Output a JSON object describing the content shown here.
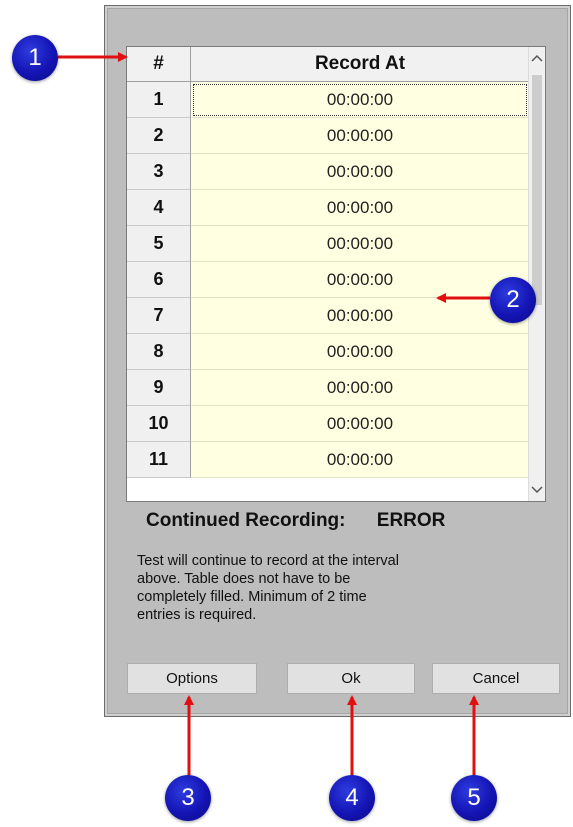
{
  "grid": {
    "header": {
      "index": "#",
      "record_at": "Record At"
    },
    "rows": [
      {
        "index": "1",
        "time": "00:00:00"
      },
      {
        "index": "2",
        "time": "00:00:00"
      },
      {
        "index": "3",
        "time": "00:00:00"
      },
      {
        "index": "4",
        "time": "00:00:00"
      },
      {
        "index": "5",
        "time": "00:00:00"
      },
      {
        "index": "6",
        "time": "00:00:00"
      },
      {
        "index": "7",
        "time": "00:00:00"
      },
      {
        "index": "8",
        "time": "00:00:00"
      },
      {
        "index": "9",
        "time": "00:00:00"
      },
      {
        "index": "10",
        "time": "00:00:00"
      },
      {
        "index": "11",
        "time": "00:00:00"
      }
    ],
    "scroll_up_icon": "chevron-up-icon",
    "scroll_down_icon": "chevron-down-icon"
  },
  "status": {
    "label": "Continued Recording:",
    "value": "ERROR"
  },
  "description": {
    "lines": [
      "Test will continue to record at the interval",
      "above.  Table does not have to be",
      "completely filled.  Minimum of 2 time",
      "entries is required."
    ]
  },
  "buttons": {
    "options": "Options",
    "ok": "Ok",
    "cancel": "Cancel"
  },
  "callouts": {
    "m1": "1",
    "m2": "2",
    "m3": "3",
    "m4": "4",
    "m5": "5"
  },
  "colors": {
    "dialog_bg": "#bdbdbd",
    "cell_yellow": "#ffffe1",
    "marker_blue": "#1414b4",
    "arrow_red": "#e01010"
  }
}
